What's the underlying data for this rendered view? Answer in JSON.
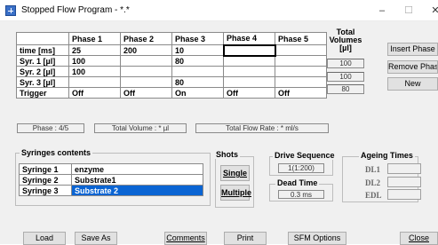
{
  "window": {
    "title": "Stopped Flow Program - *.*",
    "minimize": "–",
    "maximize": "☐",
    "close": "✕"
  },
  "grid": {
    "headers": [
      "",
      "Phase 1",
      "Phase 2",
      "Phase 3",
      "Phase 4",
      "Phase 5"
    ],
    "rows": [
      {
        "label": "time [ms]",
        "cells": [
          "25",
          "200",
          "10",
          "",
          ""
        ]
      },
      {
        "label": "Syr. 1 [µl]",
        "cells": [
          "100",
          "",
          "80",
          "",
          ""
        ]
      },
      {
        "label": "Syr. 2 [µl]",
        "cells": [
          "100",
          "",
          "",
          "",
          ""
        ]
      },
      {
        "label": "Syr. 3 [µl]",
        "cells": [
          "",
          "",
          "80",
          "",
          ""
        ]
      },
      {
        "label": "Trigger",
        "cells": [
          "Off",
          "Off",
          "On",
          "Off",
          "Off"
        ]
      }
    ]
  },
  "totals": {
    "title": "Total Volumes [µl]",
    "values": [
      "100",
      "100",
      "80"
    ]
  },
  "phase_buttons": {
    "insert": "Insert Phase",
    "remove": "Remove Phase",
    "new": "New"
  },
  "status": {
    "phase": "Phase : 4/5",
    "total_volume": "Total Volume : * µl",
    "flow_rate": "Total Flow Rate : * ml/s"
  },
  "syringes": {
    "title": "Syringes contents",
    "items": [
      {
        "name": "Syringe  1",
        "content": "enzyme"
      },
      {
        "name": "Syringe  2",
        "content": "Substrate1"
      },
      {
        "name": "Syringe  3",
        "content": "Substrate 2"
      }
    ]
  },
  "shots": {
    "title": "Shots",
    "single": "Single",
    "multiple": "Multiple"
  },
  "drive": {
    "title": "Drive Sequence",
    "value": "1(1:200)"
  },
  "dead": {
    "title": "Dead Time",
    "value": "0.3 ms"
  },
  "ageing": {
    "title": "Ageing Times",
    "labels": [
      "DL1",
      "DL2",
      "EDL"
    ]
  },
  "bottom": {
    "load": "Load",
    "saveas": "Save As",
    "comments": "Comments",
    "print": "Print",
    "sfm": "SFM Options",
    "close": "Close"
  }
}
